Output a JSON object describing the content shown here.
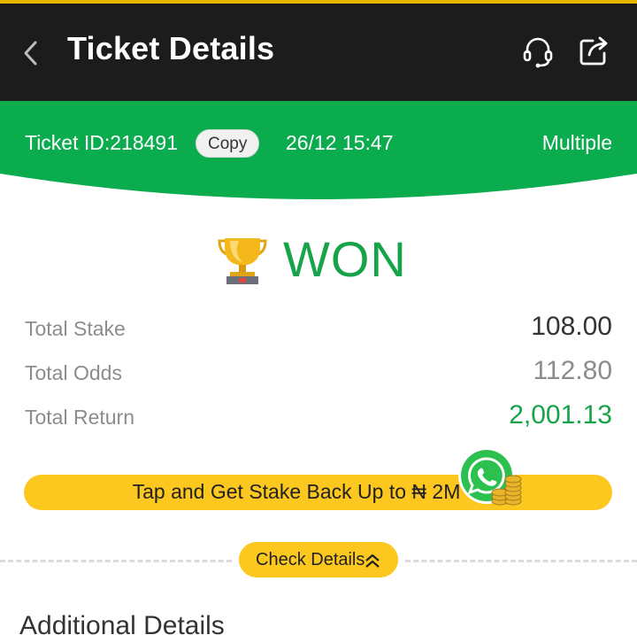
{
  "header": {
    "title": "Ticket Details",
    "icons": [
      "back-arrow-icon",
      "headset-icon",
      "share-icon"
    ]
  },
  "ticket": {
    "id_label": "Ticket ID:218491",
    "copy_label": "Copy",
    "datetime": "26/12 15:47",
    "bet_type": "Multiple"
  },
  "status": {
    "text": "WON",
    "icon": "trophy-icon",
    "color": "#17a34a"
  },
  "summary": {
    "stake_label": "Total Stake",
    "stake_value": "108.00",
    "odds_label": "Total Odds",
    "odds_value": "112.80",
    "return_label": "Total Return",
    "return_value": "2,001.13"
  },
  "promo": {
    "text": "Tap and Get Stake Back Up to ₦ 2M",
    "icon": "whatsapp-coins-icon"
  },
  "details": {
    "check_label": "Check Details",
    "additional_heading": "Additional Details"
  },
  "colors": {
    "header_bg": "#1c1c1c",
    "accent_green": "#0aac4e",
    "accent_yellow": "#fcc71e"
  }
}
